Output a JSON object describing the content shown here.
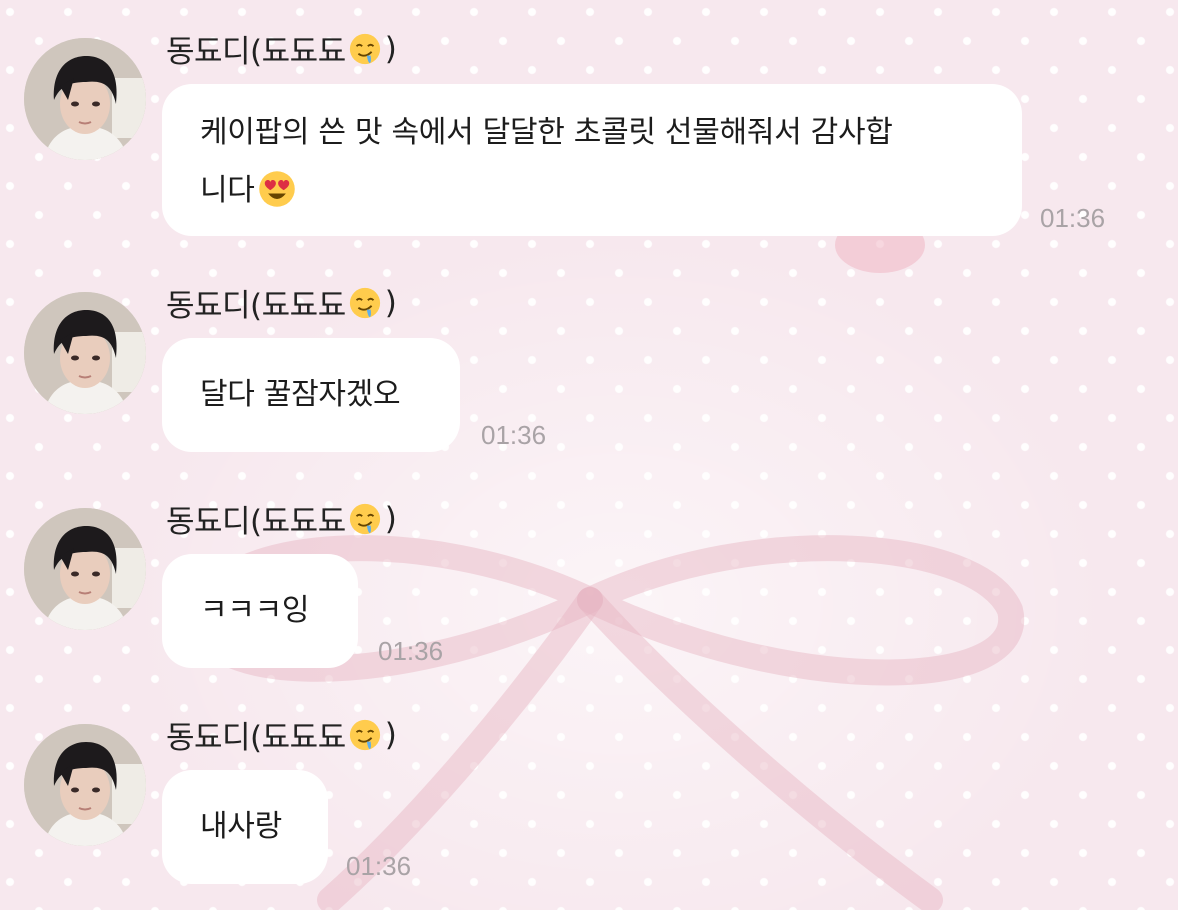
{
  "messages": [
    {
      "sender": "동됴디(됴됴됴",
      "sender_suffix": ")",
      "text_line1": "케이팝의 쓴 맛 속에서 달달한 초콜릿 선물해줘서 감사합",
      "text_line2": "니다",
      "trailing_emoji": "heart-eyes-emoji",
      "time": "01:36"
    },
    {
      "sender": "동됴디(됴됴됴",
      "sender_suffix": ")",
      "text": "달다 꿀잠자겠오",
      "time": "01:36"
    },
    {
      "sender": "동됴디(됴됴됴",
      "sender_suffix": ")",
      "text": "ㅋㅋㅋ잉",
      "time": "01:36"
    },
    {
      "sender": "동됴디(됴됴됴",
      "sender_suffix": ")",
      "text": "내사랑",
      "time": "01:36"
    }
  ],
  "sender_emoji": "drooling-face-emoji",
  "colors": {
    "background": "#f7e8ee",
    "bubble": "#ffffff",
    "timestamp": "#a9a3a6",
    "ribbon": "#e6a9bb"
  }
}
